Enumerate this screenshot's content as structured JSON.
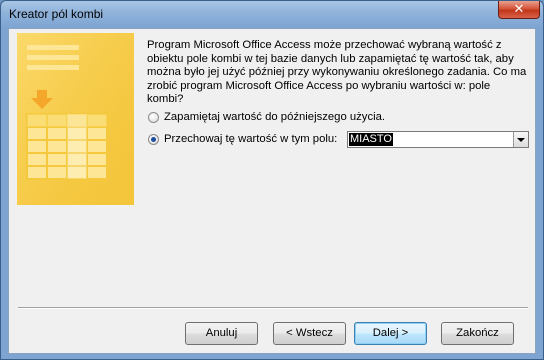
{
  "window": {
    "title": "Kreator pól kombi",
    "close_symbol": "✕"
  },
  "message": "Program Microsoft Office Access może przechować wybraną wartość z obiektu pole kombi w tej bazie danych lub zapamiętać tę wartość tak, aby można było jej użyć później przy wykonywaniu określonego zadania. Co ma zrobić program Microsoft Office Access po wybraniu wartości w: pole kombi?",
  "options": {
    "remember": {
      "label": "Zapamiętaj wartość do późniejszego użycia.",
      "selected": false
    },
    "store": {
      "label": "Przechowaj tę wartość w tym polu:",
      "selected": true
    }
  },
  "field_combo": {
    "value": "MIASTO"
  },
  "buttons": {
    "cancel": "Anuluj",
    "back": "< Wstecz",
    "next": "Dalej >",
    "finish": "Zakończ"
  },
  "colors": {
    "illustration": "#f5c93e",
    "illustration_light": "#fde796",
    "selection": "#000000",
    "titlebar": "#7ea5d2"
  }
}
